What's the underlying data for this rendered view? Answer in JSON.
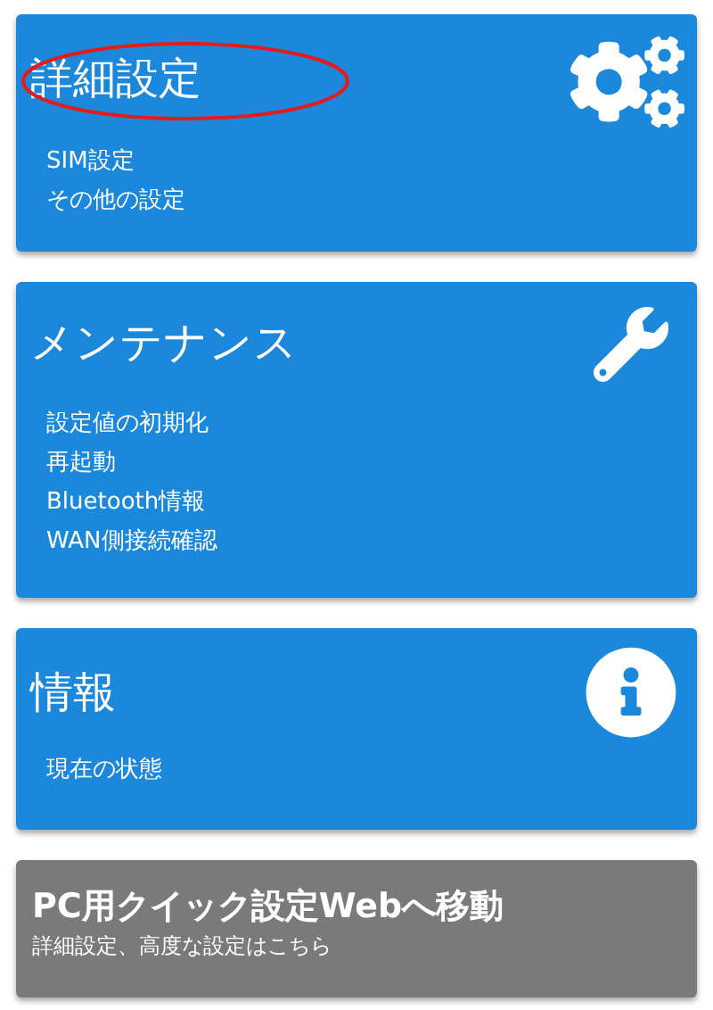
{
  "cards": [
    {
      "kind": "gears",
      "title": "詳細設定",
      "highlighted": true,
      "items": [
        "SIM設定",
        "その他の設定"
      ]
    },
    {
      "kind": "wrench",
      "title": "メンテナンス",
      "highlighted": false,
      "items": [
        "設定値の初期化",
        "再起動",
        "Bluetooth情報",
        "WAN側接続確認"
      ]
    },
    {
      "kind": "info",
      "title": "情報",
      "highlighted": false,
      "items": [
        "現在の状態"
      ]
    }
  ],
  "web_link": {
    "title": "PC用クイック設定Webへ移動",
    "subtitle": "詳細設定、高度な設定はこちら"
  }
}
